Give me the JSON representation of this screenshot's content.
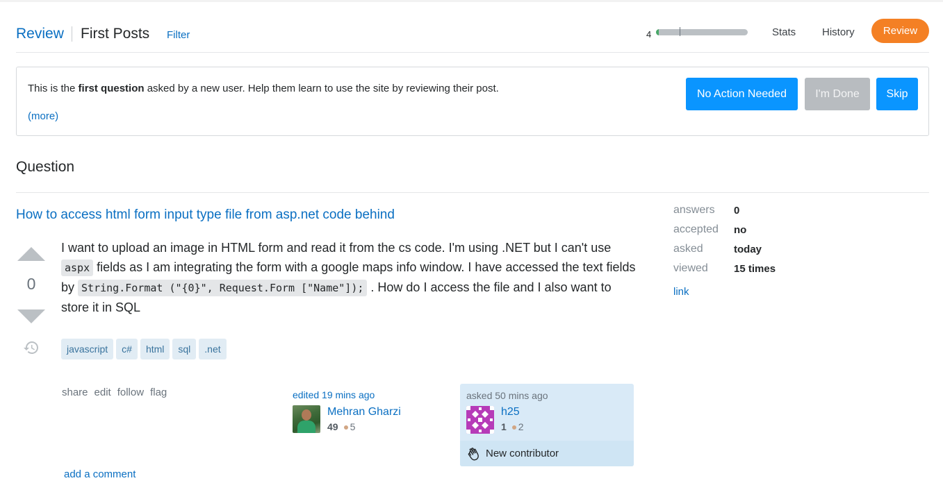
{
  "header": {
    "review_label": "Review",
    "queue_title": "First Posts",
    "filter_label": "Filter",
    "progress_count": "4",
    "progress_fraction": 0.03,
    "stats_label": "Stats",
    "history_label": "History",
    "review_button_label": "Review"
  },
  "notice": {
    "text_before": "This is the ",
    "text_bold": "first question",
    "text_after": " asked by a new user. Help them learn to use the site by reviewing their post.",
    "more_label": "(more)"
  },
  "actions": {
    "no_action_label": "No Action Needed",
    "done_label": "I'm Done",
    "skip_label": "Skip"
  },
  "section": {
    "title": "Question"
  },
  "question": {
    "title": "How to access html form input type file from asp.net code behind",
    "vote_count": "0",
    "body_part1": "I want to upload an image in HTML form and read it from the cs code. I'm using .NET but I can't use ",
    "code1": "aspx",
    "body_part2": " fields as I am integrating the form with a google maps info window. I have accessed the text fields by ",
    "code2": "String.Format (\"{0}\", Request.Form [\"Name\"]);",
    "body_part3": " . How do I access the file and I also want to store it in SQL",
    "tags": [
      "javascript",
      "c#",
      "html",
      "sql",
      ".net"
    ],
    "post_actions": [
      "share",
      "edit",
      "follow",
      "flag"
    ],
    "edited_label": "edited 19 mins ago",
    "editor": {
      "name": "Mehran Gharzi",
      "rep": "49",
      "bronze": "5"
    },
    "asked_label": "asked 50 mins ago",
    "owner": {
      "name": "h25",
      "rep": "1",
      "bronze": "2"
    },
    "new_contributor_label": "New contributor",
    "add_comment_label": "add a comment"
  },
  "stats": {
    "rows": [
      {
        "label": "answers",
        "value": "0"
      },
      {
        "label": "accepted",
        "value": "no"
      },
      {
        "label": "asked",
        "value": "today"
      },
      {
        "label": "viewed",
        "value": "15 times"
      }
    ],
    "link_label": "link"
  },
  "colors": {
    "link": "#0a6fc2",
    "primary_button": "#0a95ff",
    "disabled_button": "#b8bcc0",
    "review_pill": "#f48024",
    "progress_fill": "#48a868",
    "tag_bg": "#e1ecf4",
    "tag_text": "#39739d",
    "owner_card": "#d9eaf7"
  }
}
